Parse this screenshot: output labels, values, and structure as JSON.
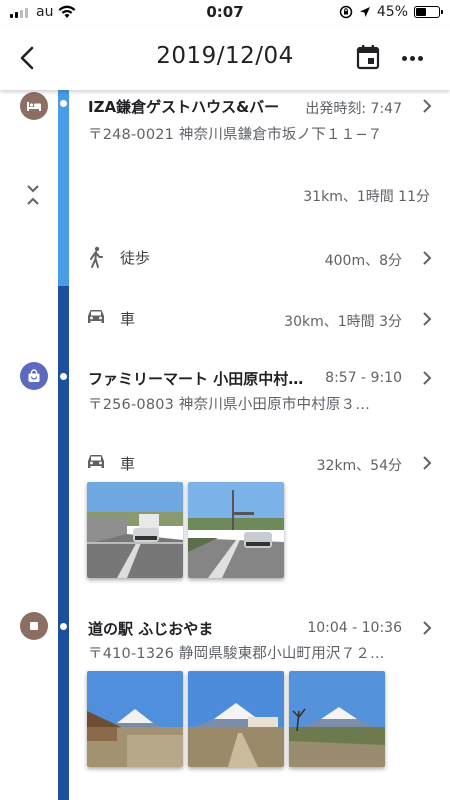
{
  "status_bar": {
    "carrier": "au",
    "time": "0:07",
    "battery": "45%",
    "battery_level": 0.45
  },
  "header": {
    "title": "2019/12/04"
  },
  "timeline": {
    "summary": "31km、1時間 11分",
    "stops": [
      {
        "name": "IZA鎌倉ゲストハウス&バー",
        "time": "出発時刻: 7:47",
        "address": "〒248-0021 神奈川県鎌倉市坂ノ下１１−７",
        "icon": "hotel-icon",
        "color": "#8D6E63"
      },
      {
        "name": "ファミリーマート 小田原中村…",
        "time": "8:57 - 9:10",
        "address": "〒256-0803 神奈川県小田原市中村原３…",
        "icon": "shopping-icon",
        "color": "#5C6BC0"
      },
      {
        "name": "道の駅 ふじおやま",
        "time": "10:04 - 10:36",
        "address": "〒410-1326 静岡県駿東郡小山町用沢７２…",
        "icon": "place-icon",
        "color": "#8D6E63"
      }
    ],
    "segments": [
      {
        "mode": "徒歩",
        "icon": "walking-icon",
        "distance": "400m、8分"
      },
      {
        "mode": "車",
        "icon": "car-icon",
        "distance": "30km、1時間 3分"
      },
      {
        "mode": "車",
        "icon": "car-icon",
        "distance": "32km、54分"
      }
    ]
  },
  "colors": {
    "timeline_walk": "#4A9BE8",
    "timeline_drive": "#1E4E9E"
  }
}
